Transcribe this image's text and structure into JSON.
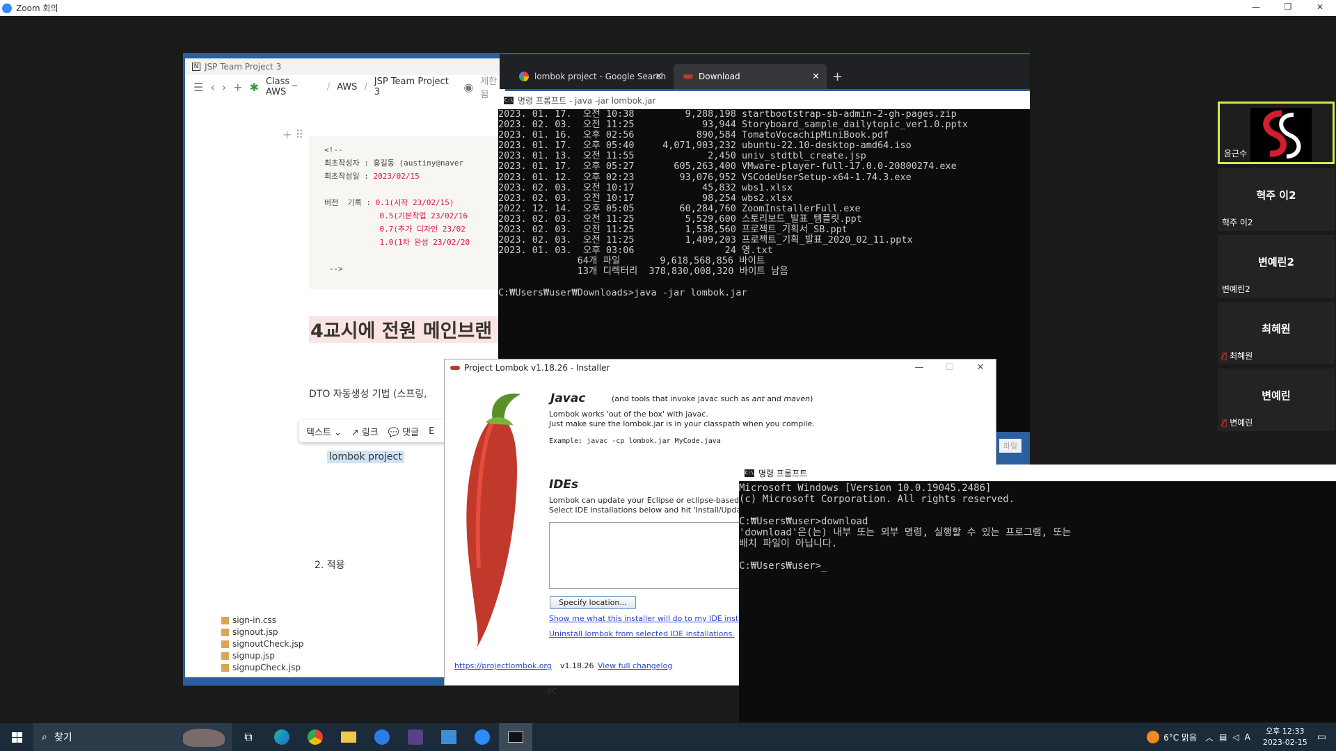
{
  "zoom": {
    "title": "Zoom 회의",
    "controls": [
      "—",
      "❐",
      "✕"
    ]
  },
  "notion": {
    "window_title": "JSP Team Project 3",
    "breadcrumbs": [
      "Class _ AWS",
      "AWS",
      "JSP Team Project 3"
    ],
    "share_label": "제한됨",
    "code_lines": {
      "open": "<!--",
      "author_key": "최초작성자 : ",
      "author_val": "홍길동 (austiny@naver",
      "date_key": "최초작성일 : ",
      "date_val": "2023/02/15",
      "ver_key": "버전  기록 : ",
      "ver1": "0.1(시작 23/02/15)",
      "ver2": "0.5(기본작업 23/02/16",
      "ver3": "0.7(추가 디자인 23/02",
      "ver4": "1.0(1차 완성 23/02/20",
      "close": "-->"
    },
    "heading": "4교시에 전원 메인브랜",
    "dto_text": "DTO 자동생성 기법 (스프링,",
    "toolbar": {
      "text": "텍스트 ⌄",
      "link": "↗ 링크",
      "comment": "💬 댓글",
      "more": "E"
    },
    "selected_text": "lombok project",
    "apply": "2.  적용"
  },
  "eclipse": {
    "files": [
      "sign-in.css",
      "signout.jsp",
      "signoutCheck.jsp",
      "signup.jsp",
      "signupCheck.jsp"
    ],
    "tree_item": "내 PC"
  },
  "chrome": {
    "tabs": [
      {
        "label": "lombok project - Google Search"
      },
      {
        "label": "Download"
      }
    ],
    "new_tab": "+"
  },
  "cmd1": {
    "title": "명령 프롬프트 - java  -jar lombok.jar",
    "lines": [
      "2023. 01. 17.  오전 10:38         9,288,198 startbootstrap-sb-admin-2-gh-pages.zip",
      "2023. 02. 03.  오전 11:25            93,944 Storyboard_sample_dailytopic_ver1.0.pptx",
      "2023. 01. 16.  오후 02:56           890,584 TomatoVocachipMiniBook.pdf",
      "2023. 01. 17.  오후 05:40     4,071,903,232 ubuntu-22.10-desktop-amd64.iso",
      "2023. 01. 13.  오전 11:55             2,450 univ_stdtbl_create.jsp",
      "2023. 01. 17.  오후 05:27       605,263,400 VMware-player-full-17.0.0-20800274.exe",
      "2023. 01. 12.  오후 02:23        93,076,952 VSCodeUserSetup-x64-1.74.3.exe",
      "2023. 02. 03.  오전 10:17            45,832 wbs1.xlsx",
      "2023. 02. 03.  오전 10:17            98,254 wbs2.xlsx",
      "2022. 12. 14.  오후 05:05        60,284,760 ZoomInstallerFull.exe",
      "2023. 02. 03.  오전 11:25         5,529,600 스토리보드_발표_템플릿.ppt",
      "2023. 02. 03.  오전 11:25         1,538,560 프로젝트_기획서_SB.ppt",
      "2023. 02. 03.  오전 11:25         1,409,203 프로젝트_기획_발표_2020_02_11.pptx",
      "2023. 01. 03.  오후 03:06                24 영.txt",
      "              64개 파일       9,618,568,856 바이트",
      "              13개 디렉터리  378,830,008,320 바이트 남음",
      "",
      "C:₩Users₩user₩Downloads>java -jar lombok.jar"
    ],
    "partial_label": "파일"
  },
  "lombok": {
    "title": "Project Lombok v1.18.26 - Installer",
    "javac_heading": "Javac",
    "javac_sub_plain": "(and tools that invoke javac such as ",
    "javac_sub_ant": "ant",
    "javac_sub_and": " and ",
    "javac_sub_maven": "maven",
    "javac_sub_end": ")",
    "works_line1": "Lombok works 'out of the box' with javac.",
    "works_line2": "Just make sure the lombok.jar is in your classpath when you compile.",
    "example": "Example: javac -cp lombok.jar MyCode.java",
    "ides_heading": "IDEs",
    "ides_line1": "Lombok can update your Eclipse or eclipse-based",
    "ides_line2": "Select IDE installations below and hit 'Install/Updat",
    "specify_button": "Specify location...",
    "show_link": "Show me what this installer will do to my IDE insta",
    "uninstall_link": "Uninstall lombok from selected IDE installations.",
    "url": "https://projectlombok.org",
    "version": "v1.18.26",
    "changelog": "View full changelog"
  },
  "cmd2": {
    "title": "명령 프롬프트",
    "lines": [
      "Microsoft Windows [Version 10.0.19045.2486]",
      "(c) Microsoft Corporation. All rights reserved.",
      "",
      "C:₩Users₩user>download",
      "'download'은(는) 내부 또는 외부 명령, 실행할 수 있는 프로그램, 또는",
      "배치 파일이 아닙니다.",
      "",
      "C:₩Users₩user>_"
    ]
  },
  "participants": [
    {
      "name": "윤근수",
      "active": true
    },
    {
      "big": "혁주 이2",
      "name": "혁주 이2",
      "muted": false
    },
    {
      "big": "변예린2",
      "name": "변예린2",
      "muted": false
    },
    {
      "big": "최혜원",
      "name": "최혜원",
      "muted": true
    },
    {
      "big": "변예린",
      "name": "변예린",
      "muted": true
    }
  ],
  "taskbar": {
    "search": "찾기",
    "weather": "6°C  맑음",
    "ime": "A",
    "time": "오후 12:33",
    "date": "2023-02-15"
  },
  "colors": {
    "zoom_blue": "#2d8cff",
    "active_speaker": "#d6e94d",
    "link": "#2647c9",
    "taskbar": "#1c2b3a"
  }
}
